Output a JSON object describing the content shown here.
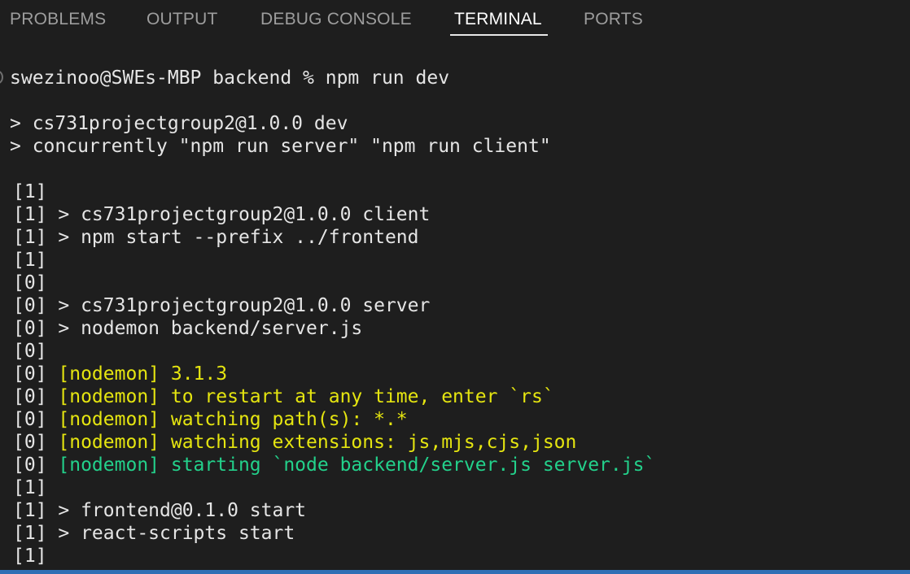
{
  "tabs": [
    {
      "label": "PROBLEMS"
    },
    {
      "label": "OUTPUT"
    },
    {
      "label": "DEBUG CONSOLE"
    },
    {
      "label": "TERMINAL",
      "active": true
    },
    {
      "label": "PORTS"
    }
  ],
  "terminal": {
    "lines": [
      {
        "prefix": "",
        "text": "swezinoo@SWEs-MBP backend % npm run dev"
      },
      {
        "prefix": "",
        "text": ""
      },
      {
        "prefix": "",
        "text": "> cs731projectgroup2@1.0.0 dev"
      },
      {
        "prefix": "",
        "text": "> concurrently \"npm run server\" \"npm run client\""
      },
      {
        "prefix": "",
        "text": ""
      },
      {
        "prefix": "[1]",
        "text": ""
      },
      {
        "prefix": "[1]",
        "text": " > cs731projectgroup2@1.0.0 client"
      },
      {
        "prefix": "[1]",
        "text": " > npm start --prefix ../frontend"
      },
      {
        "prefix": "[1]",
        "text": ""
      },
      {
        "prefix": "[0]",
        "text": ""
      },
      {
        "prefix": "[0]",
        "text": " > cs731projectgroup2@1.0.0 server"
      },
      {
        "prefix": "[0]",
        "text": " > nodemon backend/server.js"
      },
      {
        "prefix": "[0]",
        "text": ""
      },
      {
        "prefix": "[0]",
        "text": " [nodemon] 3.1.3",
        "color": "yellow"
      },
      {
        "prefix": "[0]",
        "text": " [nodemon] to restart at any time, enter `rs`",
        "color": "yellow"
      },
      {
        "prefix": "[0]",
        "text": " [nodemon] watching path(s): *.*",
        "color": "yellow"
      },
      {
        "prefix": "[0]",
        "text": " [nodemon] watching extensions: js,mjs,cjs,json",
        "color": "yellow"
      },
      {
        "prefix": "[0]",
        "text": " [nodemon] starting `node backend/server.js server.js`",
        "color": "green"
      },
      {
        "prefix": "[1]",
        "text": ""
      },
      {
        "prefix": "[1]",
        "text": " > frontend@0.1.0 start"
      },
      {
        "prefix": "[1]",
        "text": " > react-scripts start"
      },
      {
        "prefix": "[1]",
        "text": ""
      }
    ]
  },
  "colors": {
    "background": "#1e1e1e",
    "text": "#e5e5e5",
    "yellow": "#e5e510",
    "green": "#23d18b",
    "statusbar": "#2f6fb5"
  }
}
